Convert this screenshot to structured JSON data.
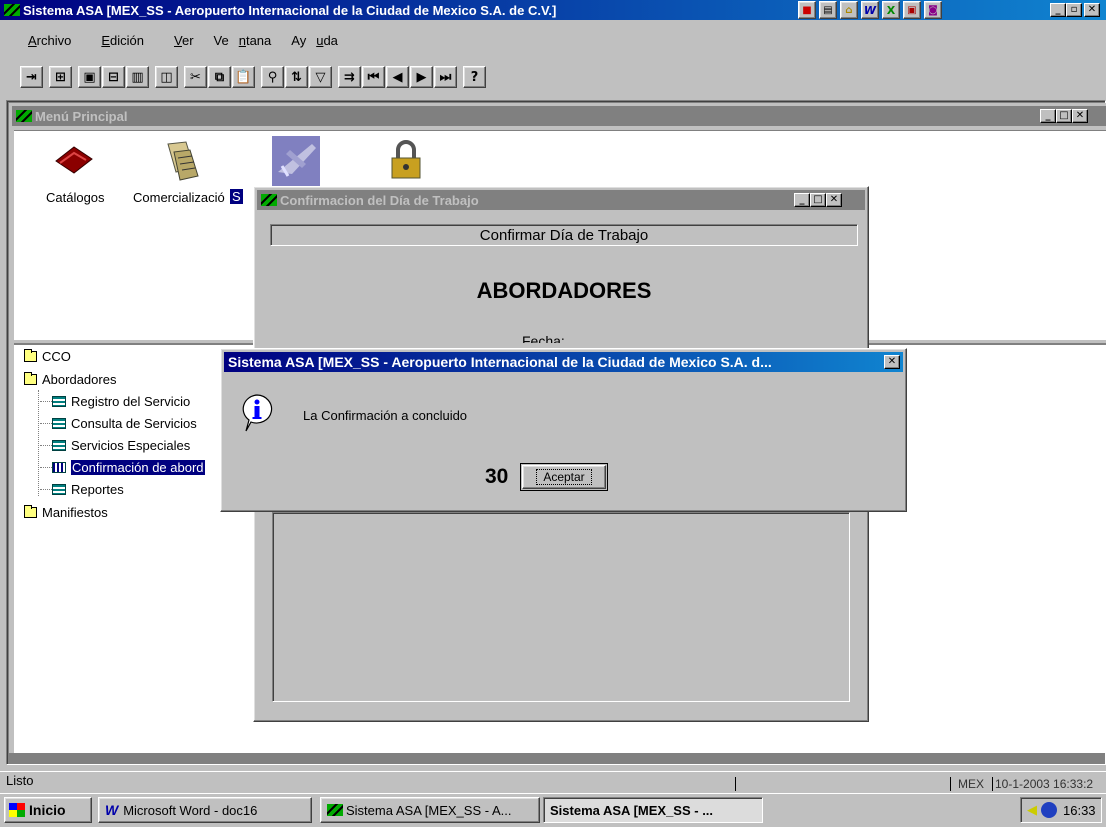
{
  "app": {
    "title": "Sistema ASA [MEX_SS - Aeropuerto Internacional de la Ciudad de Mexico S.A. de C.V.]"
  },
  "menu": {
    "items": [
      {
        "pre": "",
        "key": "A",
        "post": "rchivo"
      },
      {
        "pre": "",
        "key": "E",
        "post": "dición"
      },
      {
        "pre": "",
        "key": "V",
        "post": "er"
      },
      {
        "pre": "Ve",
        "key": "n",
        "post": "tana"
      },
      {
        "pre": "Ay",
        "key": "u",
        "post": "da"
      }
    ]
  },
  "menu_principal": {
    "title": "Menú Principal",
    "icons": [
      {
        "label": "Catálogos",
        "icon": "book-icon"
      },
      {
        "label": "Comercializació",
        "icon": "documents-icon"
      },
      {
        "label": "S",
        "icon": "airplane-icon"
      },
      {
        "label": "",
        "icon": "padlock-icon"
      }
    ]
  },
  "tree": {
    "items": [
      {
        "label": "CCO",
        "type": "folder",
        "level": 0
      },
      {
        "label": "Abordadores",
        "type": "folder",
        "level": 0
      },
      {
        "label": "Registro del Servicio",
        "type": "sheet",
        "level": 1
      },
      {
        "label": "Consulta de Servicios",
        "type": "sheet",
        "level": 1
      },
      {
        "label": "Servicios Especiales",
        "type": "sheet",
        "level": 1
      },
      {
        "label": "Confirmación de abord",
        "type": "sheet",
        "level": 1,
        "selected": true
      },
      {
        "label": "Reportes",
        "type": "sheet",
        "level": 1
      },
      {
        "label": "Manifiestos",
        "type": "folder",
        "level": 0
      }
    ]
  },
  "confirm_window": {
    "title": "Confirmacion del Día de Trabajo",
    "header": "Confirmar Día de Trabajo",
    "heading": "ABORDADORES",
    "fecha_label": "Fecha:"
  },
  "message_box": {
    "title": "Sistema ASA [MEX_SS - Aeropuerto Internacional de la Ciudad de Mexico S.A. d...",
    "message": "La Confirmación a concluido",
    "counter": "30",
    "ok_label": "Aceptar",
    "icon": "info-icon"
  },
  "status": {
    "text": "Listo",
    "server": "MEX",
    "datetime": "10-1-2003 16:33:2"
  },
  "taskbar": {
    "start": "Inicio",
    "tasks": [
      {
        "label": "Microsoft Word - doc16",
        "icon": "word-icon"
      },
      {
        "label": "Sistema ASA [MEX_SS - A...",
        "icon": "asa-icon"
      },
      {
        "label": "Sistema ASA [MEX_SS - ...",
        "icon": "none",
        "active": true
      }
    ],
    "clock": "16:33"
  }
}
